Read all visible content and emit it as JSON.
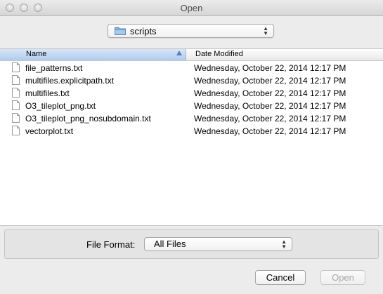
{
  "window": {
    "title": "Open"
  },
  "location": {
    "folder": "scripts",
    "icon": "folder-icon"
  },
  "columns": {
    "name": "Name",
    "date_modified": "Date Modified",
    "sort": "ascending"
  },
  "files": [
    {
      "name": "file_patterns.txt",
      "date": "Wednesday, October 22, 2014 12:17 PM"
    },
    {
      "name": "multifiles.explicitpath.txt",
      "date": "Wednesday, October 22, 2014 12:17 PM"
    },
    {
      "name": "multifiles.txt",
      "date": "Wednesday, October 22, 2014 12:17 PM"
    },
    {
      "name": "O3_tileplot_png.txt",
      "date": "Wednesday, October 22, 2014 12:17 PM"
    },
    {
      "name": "O3_tileplot_png_nosubdomain.txt",
      "date": "Wednesday, October 22, 2014 12:17 PM"
    },
    {
      "name": "vectorplot.txt",
      "date": "Wednesday, October 22, 2014 12:17 PM"
    }
  ],
  "format": {
    "label": "File Format:",
    "value": "All Files"
  },
  "buttons": {
    "cancel": "Cancel",
    "open": "Open"
  },
  "colors": {
    "header_selected": "#b1cbed",
    "folder_blue": "#6fa8dc"
  }
}
